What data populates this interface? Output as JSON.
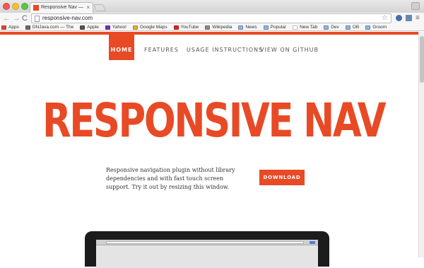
{
  "browser": {
    "tab_title": "Responsive Nav — Respo",
    "tab_close": "×",
    "url": "responsive-nav.com",
    "icons": {
      "back": "←",
      "forward": "→",
      "reload": "C",
      "star": "☆",
      "menu": "≡"
    },
    "bookmarks": [
      {
        "label": "Apps",
        "color": "#d94b3d"
      },
      {
        "label": "DNJava.com — The",
        "color": "#6b6b6b"
      },
      {
        "label": "Apple",
        "color": "#555555"
      },
      {
        "label": "Yahoo!",
        "color": "#7b2fbf"
      },
      {
        "label": "Google Maps",
        "color": "#e1b12f"
      },
      {
        "label": "YouTube",
        "color": "#e62117"
      },
      {
        "label": "Wikipedia",
        "color": "#8a8a8a"
      },
      {
        "label": "News",
        "color": "#8fb5e0"
      },
      {
        "label": "Popular",
        "color": "#8fb5e0"
      },
      {
        "label": "New Tab",
        "color": "#ffffff"
      },
      {
        "label": "Dev",
        "color": "#8fb5e0"
      },
      {
        "label": "OB",
        "color": "#8fb5e0"
      },
      {
        "label": "Groom",
        "color": "#8fb5e0"
      }
    ]
  },
  "page": {
    "accent_color": "#e84a25",
    "nav": {
      "home": "HOME",
      "features": "FEATURES",
      "usage": "USAGE INSTRUCTIONS",
      "github": "VIEW ON GITHUB"
    },
    "hero_title": "RESPONSIVE NAV",
    "description": "Responsive navigation plugin without library dependencies and with fast touch screen support. Try it out by resizing this window.",
    "download_label": "DOWNLOAD"
  }
}
